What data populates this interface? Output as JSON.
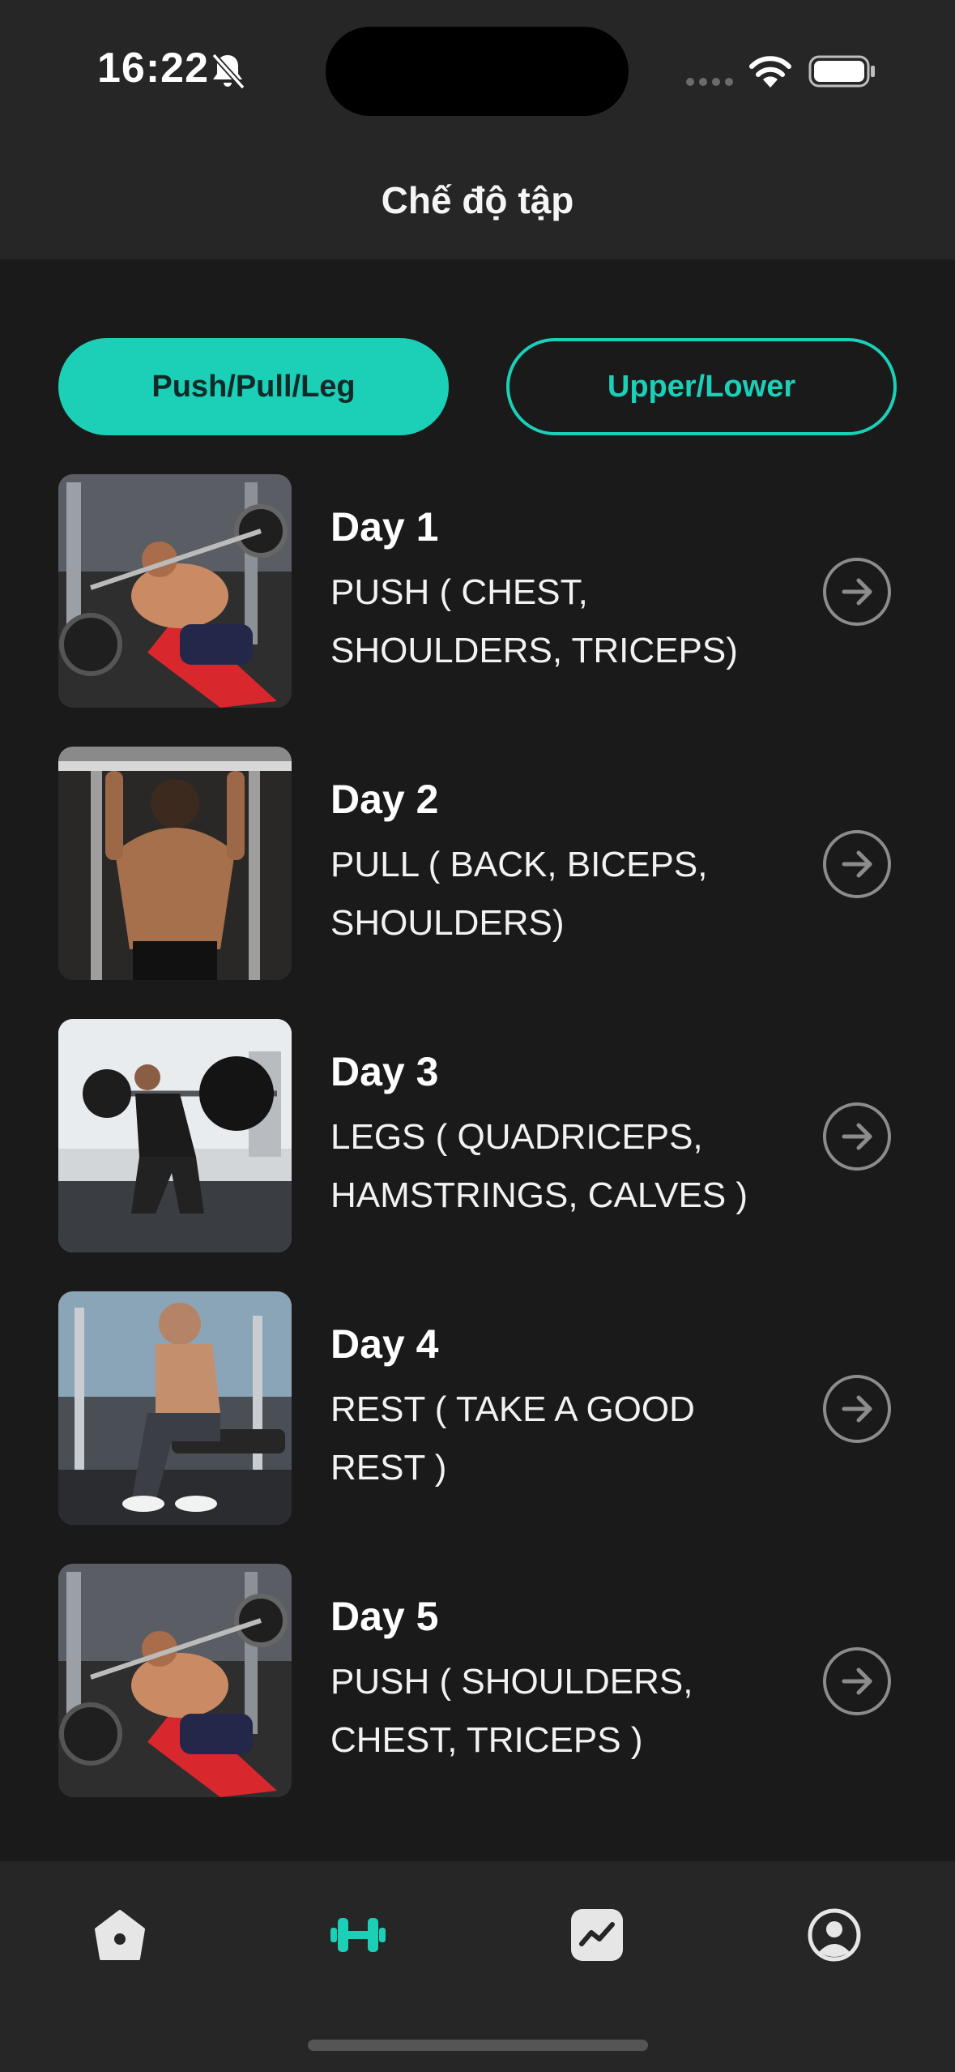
{
  "status_bar": {
    "time": "16:22",
    "icons": [
      "bell-slash-icon",
      "cellular-signal-icon",
      "wifi-icon",
      "battery-icon"
    ]
  },
  "header": {
    "title": "Chế độ tập"
  },
  "tabs": [
    {
      "label": "Push/Pull/Leg",
      "selected": true
    },
    {
      "label": "Upper/Lower",
      "selected": false
    }
  ],
  "days": [
    {
      "title": "Day 1",
      "description": "PUSH ( CHEST, SHOULDERS, TRICEPS)"
    },
    {
      "title": "Day 2",
      "description": "PULL ( BACK, BICEPS, SHOULDERS)"
    },
    {
      "title": "Day 3",
      "description": "LEGS ( QUADRICEPS, HAMSTRINGS, CALVES )"
    },
    {
      "title": "Day 4",
      "description": "REST ( TAKE A GOOD REST )"
    },
    {
      "title": "Day 5",
      "description": "PUSH ( SHOULDERS, CHEST, TRICEPS )"
    }
  ],
  "bottom_nav": [
    {
      "icon": "home-icon",
      "active": false
    },
    {
      "icon": "dumbbell-icon",
      "active": true
    },
    {
      "icon": "chart-icon",
      "active": false
    },
    {
      "icon": "profile-icon",
      "active": false
    }
  ],
  "colors": {
    "accent": "#1ccfb7",
    "background": "#1a1a1a",
    "bar_background": "#262626",
    "inactive_icon": "#e6e6e6"
  }
}
